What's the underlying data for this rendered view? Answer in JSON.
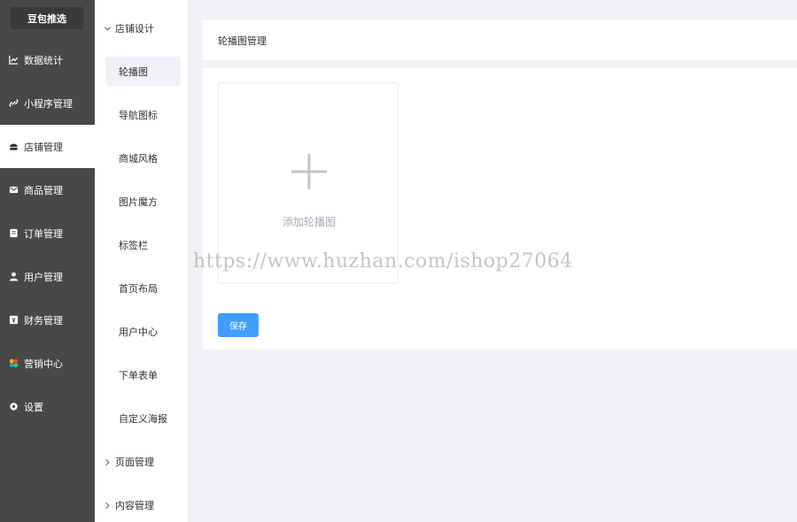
{
  "brand": "豆包推选",
  "sidebar": {
    "items": [
      {
        "label": "数据统计",
        "icon": "chart-line-icon"
      },
      {
        "label": "小程序管理",
        "icon": "link-icon"
      },
      {
        "label": "店铺管理",
        "icon": "shop-icon",
        "active": true
      },
      {
        "label": "商品管理",
        "icon": "envelope-icon"
      },
      {
        "label": "订单管理",
        "icon": "order-icon"
      },
      {
        "label": "用户管理",
        "icon": "user-icon"
      },
      {
        "label": "财务管理",
        "icon": "finance-icon"
      },
      {
        "label": "营销中心",
        "icon": "marketing-icon"
      },
      {
        "label": "设置",
        "icon": "gear-icon"
      }
    ]
  },
  "submenu": {
    "group_store_design": "店铺设计",
    "items": [
      "轮播图",
      "导航图标",
      "商城风格",
      "图片魔方",
      "标签栏",
      "首页布局",
      "用户中心",
      "下单表单",
      "自定义海报"
    ],
    "group_page_mgmt": "页面管理",
    "group_content_mgmt": "内容管理"
  },
  "main": {
    "title": "轮播图管理",
    "upload_label": "添加轮播图",
    "save_label": "保存"
  },
  "watermark": "https://www.huzhan.com/ishop27064",
  "colors": {
    "sidebar_bg": "#484848",
    "accent": "#409eff",
    "page_bg": "#f0f2f5"
  }
}
